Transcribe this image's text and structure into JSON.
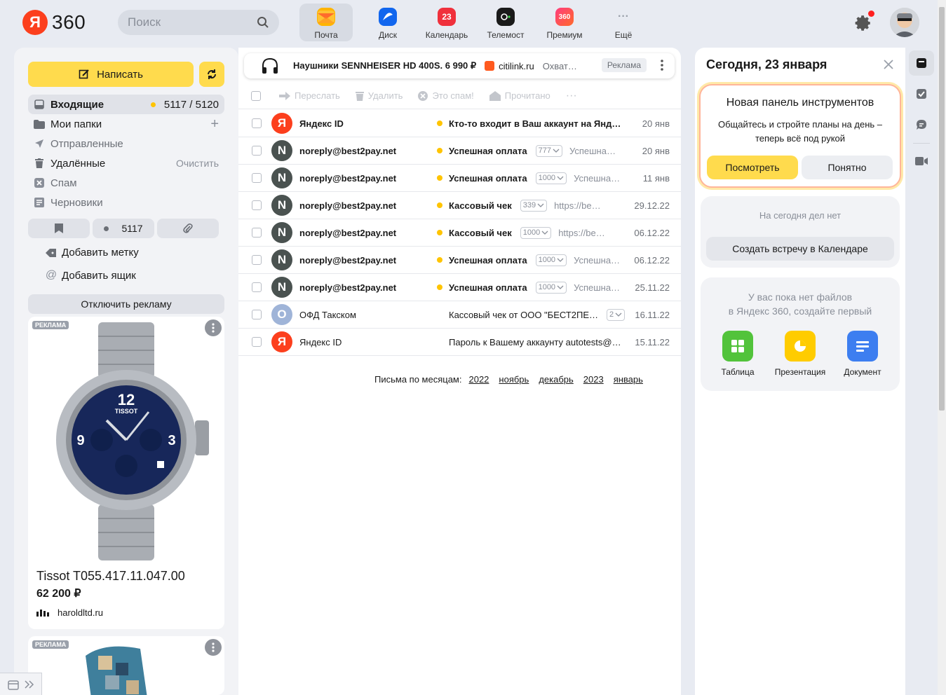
{
  "header": {
    "logo_letter": "Я",
    "logo_text": "360",
    "search_placeholder": "Поиск",
    "services": [
      {
        "label": "Почта",
        "icon": "mail-icon",
        "active": true
      },
      {
        "label": "Диск",
        "icon": "disk-icon"
      },
      {
        "label": "Календарь",
        "icon": "calendar-icon",
        "badge": "23"
      },
      {
        "label": "Телемост",
        "icon": "telemost-icon"
      },
      {
        "label": "Премиум",
        "icon": "premium-icon",
        "badge": "360"
      },
      {
        "label": "Ещё",
        "icon": "more-icon"
      }
    ]
  },
  "sidebar": {
    "compose_label": "Написать",
    "folders": [
      {
        "label": "Входящие",
        "count": "5117 / 5120"
      },
      {
        "label": "Мои папки"
      },
      {
        "label": "Отправленные"
      },
      {
        "label": "Удалённые",
        "action": "Очистить"
      },
      {
        "label": "Спам"
      },
      {
        "label": "Черновики"
      }
    ],
    "filter_unread_count": "5117",
    "add_label": "Добавить метку",
    "add_mailbox": "Добавить ящик",
    "disable_ads": "Отключить рекламу",
    "ad_badge": "РЕКЛАМА",
    "ad1": {
      "title": "Tissot T055.417.11.047.00",
      "price": "62 200 ₽",
      "domain": "haroldltd.ru"
    },
    "ad2_badge": "РЕКЛАМА"
  },
  "promo": {
    "title": "Наушники SENNHEISER HD 400S. 6 990 ₽",
    "site": "citilink.ru",
    "desc": "Охват…",
    "tag": "Реклама"
  },
  "toolbar": {
    "forward": "Переслать",
    "delete": "Удалить",
    "spam": "Это спам!",
    "read": "Прочитано"
  },
  "mails": [
    {
      "from": "Яндекс ID",
      "subject": "Кто-то входит в Ваш аккаунт на Янд…",
      "count": "",
      "snippet": "",
      "date": "20 янв",
      "unread": true,
      "avatar": "Я",
      "avatar_color": "#fc3f1d"
    },
    {
      "from": "noreply@best2pay.net",
      "subject": "Успешная оплата",
      "count": "777",
      "snippet": "Успешная …",
      "date": "20 янв",
      "unread": true,
      "avatar": "N",
      "avatar_color": "#4a5250"
    },
    {
      "from": "noreply@best2pay.net",
      "subject": "Успешная оплата",
      "count": "1000",
      "snippet": "Успешная…",
      "date": "11 янв",
      "unread": true,
      "avatar": "N",
      "avatar_color": "#4a5250"
    },
    {
      "from": "noreply@best2pay.net",
      "subject": "Кассовый чек",
      "count": "339",
      "snippet": "https://best2pa…",
      "date": "29.12.22",
      "unread": true,
      "avatar": "N",
      "avatar_color": "#4a5250"
    },
    {
      "from": "noreply@best2pay.net",
      "subject": "Кассовый чек",
      "count": "1000",
      "snippet": "https://best2p…",
      "date": "06.12.22",
      "unread": true,
      "avatar": "N",
      "avatar_color": "#4a5250"
    },
    {
      "from": "noreply@best2pay.net",
      "subject": "Успешная оплата",
      "count": "1000",
      "snippet": "Успешна…",
      "date": "06.12.22",
      "unread": true,
      "avatar": "N",
      "avatar_color": "#4a5250"
    },
    {
      "from": "noreply@best2pay.net",
      "subject": "Успешная оплата",
      "count": "1000",
      "snippet": "Успешна…",
      "date": "25.11.22",
      "unread": true,
      "avatar": "N",
      "avatar_color": "#4a5250"
    },
    {
      "from": "ОФД Такском",
      "subject": "Кассовый чек от ООО \"БЕСТ2ПЕ…",
      "count": "2",
      "snippet": "",
      "date": "16.11.22",
      "unread": false,
      "avatar": "О",
      "avatar_color": "#9fb4d8"
    },
    {
      "from": "Яндекс ID",
      "subject": "Пароль к Вашему аккаунту autotests@…",
      "count": "",
      "snippet": "",
      "date": "15.11.22",
      "unread": false,
      "avatar": "Я",
      "avatar_color": "#fc3f1d"
    }
  ],
  "months": {
    "label": "Письма по месяцам:",
    "items": [
      "2022",
      "ноябрь",
      "декабрь",
      "2023",
      "январь"
    ]
  },
  "right": {
    "title": "Сегодня, 23 января",
    "tool_title": "Новая панель инструментов",
    "tool_text": "Общайтесь и стройте планы на день – теперь всё под рукой",
    "tool_view": "Посмотреть",
    "tool_ok": "Понятно",
    "today_empty": "На сегодня дел нет",
    "today_create": "Создать встречу в Календаре",
    "files_text_1": "У вас пока нет файлов",
    "files_text_2": "в Яндекс 360, создайте первый",
    "apps": [
      {
        "label": "Таблица",
        "color": "#52c33b",
        "icon": "table-icon"
      },
      {
        "label": "Презентация",
        "color": "#ffcc00",
        "icon": "presentation-icon"
      },
      {
        "label": "Документ",
        "color": "#3d7ef0",
        "icon": "document-icon"
      }
    ]
  }
}
